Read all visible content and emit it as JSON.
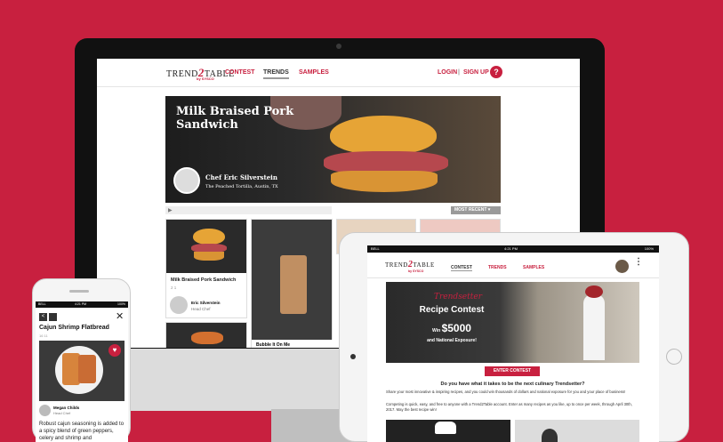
{
  "desktop": {
    "logo_main": "TREND",
    "logo_2": "2",
    "logo_end": "TABLE",
    "logo_by": "by SYSCO",
    "nav": [
      "CONTEST",
      "TRENDS",
      "SAMPLES"
    ],
    "login": "LOGIN",
    "separator": "|",
    "signup": "SIGN UP",
    "help": "?",
    "hero_title": "Milk Braised Pork Sandwich",
    "chef_name": "Chef Eric Silverstein",
    "chef_place": "The Peached Tortilla, Austin, TX",
    "sort_label": "MOST RECENT",
    "card1_title": "Milk Braised Pork Sandwich",
    "card1_stats": "2  1",
    "card1_chef": "Eric Silverstein",
    "card1_role": "Head Chef",
    "card2_title": "Bubble It On Me",
    "colors": {
      "brand": "#c8203f"
    }
  },
  "tablet": {
    "time": "4:21 PM",
    "carrier": "BELL",
    "battery": "100%",
    "logo_main": "TREND",
    "logo_2": "2",
    "logo_end": "TABLE",
    "logo_by": "by SYSCO",
    "nav": [
      "CONTEST",
      "TRENDS",
      "SAMPLES"
    ],
    "contest_script": "Trendsetter",
    "contest_title": "Recipe Contest",
    "win_prefix": "Win",
    "win_amount": "$5000",
    "win_suffix": "and National Exposure!",
    "enter_button": "ENTER CONTEST",
    "question": "Do you have what it takes to be the next culinary Trendsetter?",
    "para1": "Share your most innovative & inspiring recipes, and you could win thousands of dollars and national exposure for you and your place of business!",
    "para2": "Competing is quick, easy, and free to anyone with a Trend2Table account. Enter as many recipes as you like, up to once per week, through April 30th, 2017. May the best recipe win!"
  },
  "phone": {
    "time": "4:21 PM",
    "carrier": "BELL",
    "battery": "100%",
    "title": "Cajun Shrimp Flatbread",
    "stats": "16  11",
    "chef_name": "Megan Childs",
    "chef_role": "Head Chef",
    "description": "Robust cajun seasoning is added to a spicy blend of green peppers, celery and shrimp and"
  }
}
